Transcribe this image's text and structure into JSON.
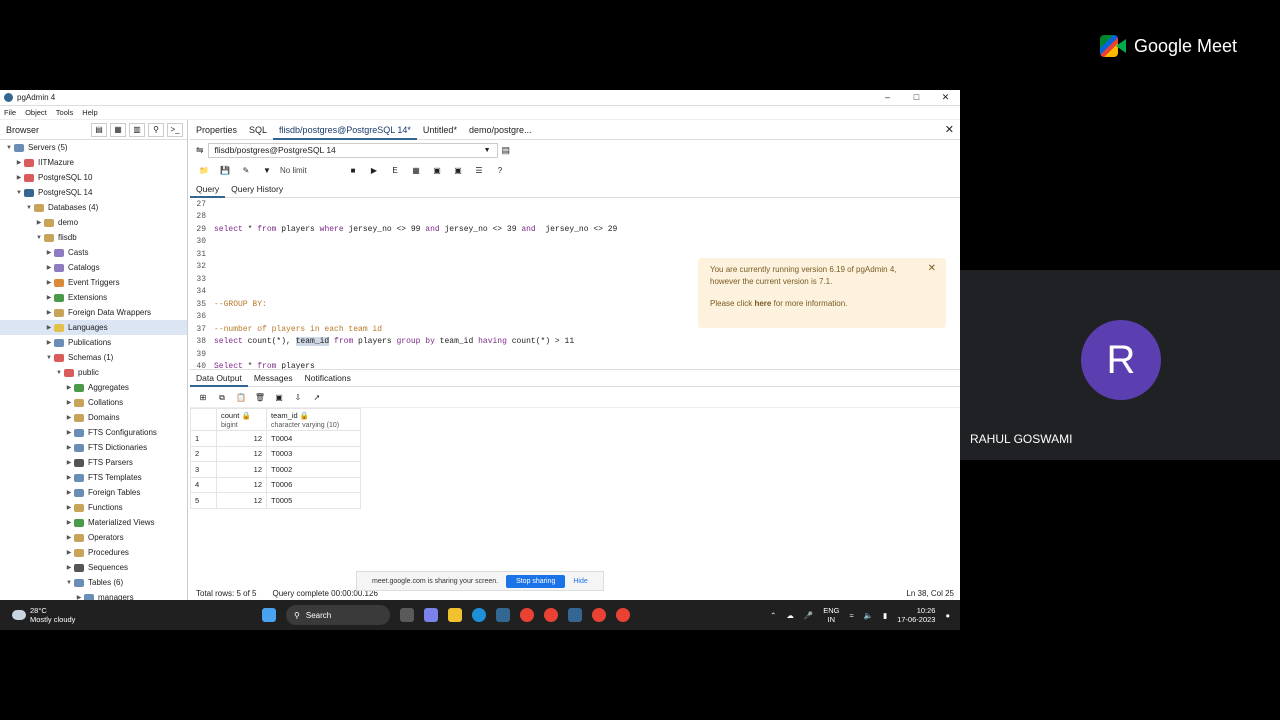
{
  "meet": {
    "brand": "Google Meet",
    "participant_initial": "R",
    "participant_name": "RAHUL GOSWAMI",
    "avatar_color": "#5b3fb0"
  },
  "window": {
    "title": "pgAdmin 4",
    "controls": [
      "–",
      "□",
      "✕"
    ]
  },
  "menu": [
    "File",
    "Object",
    "Tools",
    "Help"
  ],
  "browser": {
    "title": "Browser",
    "tree": [
      {
        "label": "Servers (5)",
        "level": 0,
        "arrow": "▼",
        "color": "#6a8db5"
      },
      {
        "label": "IITMazure",
        "level": 1,
        "arrow": "▶",
        "color": "#d95b5b"
      },
      {
        "label": "PostgreSQL 10",
        "level": 1,
        "arrow": "▶",
        "color": "#d95b5b"
      },
      {
        "label": "PostgreSQL 14",
        "level": 1,
        "arrow": "▼",
        "color": "#336791"
      },
      {
        "label": "Databases (4)",
        "level": 2,
        "arrow": "▼",
        "color": "#c8a35a"
      },
      {
        "label": "demo",
        "level": 3,
        "arrow": "▶",
        "color": "#c8a35a"
      },
      {
        "label": "flisdb",
        "level": 3,
        "arrow": "▼",
        "color": "#c8a35a"
      },
      {
        "label": "Casts",
        "level": 4,
        "arrow": "▶",
        "color": "#8e7bc2"
      },
      {
        "label": "Catalogs",
        "level": 4,
        "arrow": "▶",
        "color": "#8e7bc2"
      },
      {
        "label": "Event Triggers",
        "level": 4,
        "arrow": "▶",
        "color": "#d98a3a"
      },
      {
        "label": "Extensions",
        "level": 4,
        "arrow": "▶",
        "color": "#4a9a4a"
      },
      {
        "label": "Foreign Data Wrappers",
        "level": 4,
        "arrow": "▶",
        "color": "#c8a35a"
      },
      {
        "label": "Languages",
        "level": 4,
        "arrow": "▶",
        "color": "#e2c24a",
        "selected": true
      },
      {
        "label": "Publications",
        "level": 4,
        "arrow": "▶",
        "color": "#6a8db5"
      },
      {
        "label": "Schemas (1)",
        "level": 4,
        "arrow": "▼",
        "color": "#d95b5b"
      },
      {
        "label": "public",
        "level": 5,
        "arrow": "▼",
        "color": "#d95b5b"
      },
      {
        "label": "Aggregates",
        "level": 6,
        "arrow": "▶",
        "color": "#4a9a4a"
      },
      {
        "label": "Collations",
        "level": 6,
        "arrow": "▶",
        "color": "#c8a35a"
      },
      {
        "label": "Domains",
        "level": 6,
        "arrow": "▶",
        "color": "#c8a35a"
      },
      {
        "label": "FTS Configurations",
        "level": 6,
        "arrow": "▶",
        "color": "#6a8db5"
      },
      {
        "label": "FTS Dictionaries",
        "level": 6,
        "arrow": "▶",
        "color": "#6a8db5"
      },
      {
        "label": "FTS Parsers",
        "level": 6,
        "arrow": "▶",
        "color": "#555555"
      },
      {
        "label": "FTS Templates",
        "level": 6,
        "arrow": "▶",
        "color": "#6a8db5"
      },
      {
        "label": "Foreign Tables",
        "level": 6,
        "arrow": "▶",
        "color": "#6a8db5"
      },
      {
        "label": "Functions",
        "level": 6,
        "arrow": "▶",
        "color": "#c8a35a"
      },
      {
        "label": "Materialized Views",
        "level": 6,
        "arrow": "▶",
        "color": "#4a9a4a"
      },
      {
        "label": "Operators",
        "level": 6,
        "arrow": "▶",
        "color": "#c8a35a"
      },
      {
        "label": "Procedures",
        "level": 6,
        "arrow": "▶",
        "color": "#c8a35a"
      },
      {
        "label": "Sequences",
        "level": 6,
        "arrow": "▶",
        "color": "#555555"
      },
      {
        "label": "Tables (6)",
        "level": 6,
        "arrow": "▼",
        "color": "#6a8db5"
      },
      {
        "label": "managers",
        "level": 7,
        "arrow": "▶",
        "color": "#6a8db5"
      }
    ]
  },
  "tabs": [
    {
      "label": "Properties",
      "active": false
    },
    {
      "label": "SQL",
      "active": false
    },
    {
      "label": "flisdb/postgres@PostgreSQL 14*",
      "active": true
    },
    {
      "label": "Untitled*",
      "active": false
    },
    {
      "label": "demo/postgre...",
      "active": false
    }
  ],
  "connection": "flisdb/postgres@PostgreSQL 14",
  "limit": "No limit",
  "query_tabs": [
    "Query",
    "Query History"
  ],
  "editor_lines": [
    {
      "no": "27",
      "parts": []
    },
    {
      "no": "28",
      "parts": []
    },
    {
      "no": "29",
      "parts": [
        {
          "t": "select",
          "c": "kw"
        },
        {
          "t": " * ",
          "c": ""
        },
        {
          "t": "from",
          "c": "kw"
        },
        {
          "t": " players ",
          "c": ""
        },
        {
          "t": "where",
          "c": "kw"
        },
        {
          "t": " jersey_no <> 99 ",
          "c": ""
        },
        {
          "t": "and",
          "c": "kw"
        },
        {
          "t": " jersey_no <> 39 ",
          "c": ""
        },
        {
          "t": "and",
          "c": "kw"
        },
        {
          "t": "  jersey_no <> 29",
          "c": ""
        }
      ]
    },
    {
      "no": "30",
      "parts": []
    },
    {
      "no": "31",
      "parts": []
    },
    {
      "no": "32",
      "parts": []
    },
    {
      "no": "33",
      "parts": []
    },
    {
      "no": "34",
      "parts": []
    },
    {
      "no": "35",
      "parts": [
        {
          "t": "--GROUP BY:",
          "c": "cm"
        }
      ]
    },
    {
      "no": "36",
      "parts": []
    },
    {
      "no": "37",
      "parts": [
        {
          "t": "--number of players in each team id",
          "c": "cm"
        }
      ]
    },
    {
      "no": "38",
      "parts": [
        {
          "t": "select",
          "c": "kw"
        },
        {
          "t": " count(*), ",
          "c": ""
        },
        {
          "t": "team_id",
          "c": "hl"
        },
        {
          "t": " ",
          "c": ""
        },
        {
          "t": "from",
          "c": "kw"
        },
        {
          "t": " players ",
          "c": ""
        },
        {
          "t": "group by",
          "c": "kw"
        },
        {
          "t": " team_id ",
          "c": ""
        },
        {
          "t": "having",
          "c": "kw"
        },
        {
          "t": " count(*) > 11",
          "c": ""
        }
      ]
    },
    {
      "no": "39",
      "parts": []
    },
    {
      "no": "40",
      "parts": [
        {
          "t": "Select",
          "c": "kw"
        },
        {
          "t": " * ",
          "c": ""
        },
        {
          "t": "from",
          "c": "kw"
        },
        {
          "t": " players",
          "c": ""
        }
      ]
    }
  ],
  "notice": {
    "line1": "You are currently running version 6.19 of pgAdmin 4,",
    "line2": "however the current version is 7.1.",
    "line3_pre": "Please click ",
    "line3_link": "here",
    "line3_post": " for more information."
  },
  "output_tabs": [
    "Data Output",
    "Messages",
    "Notifications"
  ],
  "grid": {
    "columns": [
      {
        "name": "count",
        "type": "bigint"
      },
      {
        "name": "team_id",
        "type": "character varying (10)"
      }
    ],
    "rows": [
      {
        "n": "1",
        "count": "12",
        "team": "T0004"
      },
      {
        "n": "2",
        "count": "12",
        "team": "T0003"
      },
      {
        "n": "3",
        "count": "12",
        "team": "T0002"
      },
      {
        "n": "4",
        "count": "12",
        "team": "T0006"
      },
      {
        "n": "5",
        "count": "12",
        "team": "T0005"
      }
    ]
  },
  "status": {
    "rows": "Total rows: 5 of 5",
    "query": "Query complete 00:00:00.126",
    "position": "Ln 38, Col 25"
  },
  "share_bar": {
    "text": "meet.google.com is sharing your screen.",
    "stop": "Stop sharing",
    "hide": "Hide"
  },
  "taskbar": {
    "temp": "28°C",
    "weather": "Mostly cloudy",
    "search": "Search",
    "lang1": "ENG",
    "lang2": "IN",
    "time": "10:26",
    "date": "17-06-2023"
  }
}
